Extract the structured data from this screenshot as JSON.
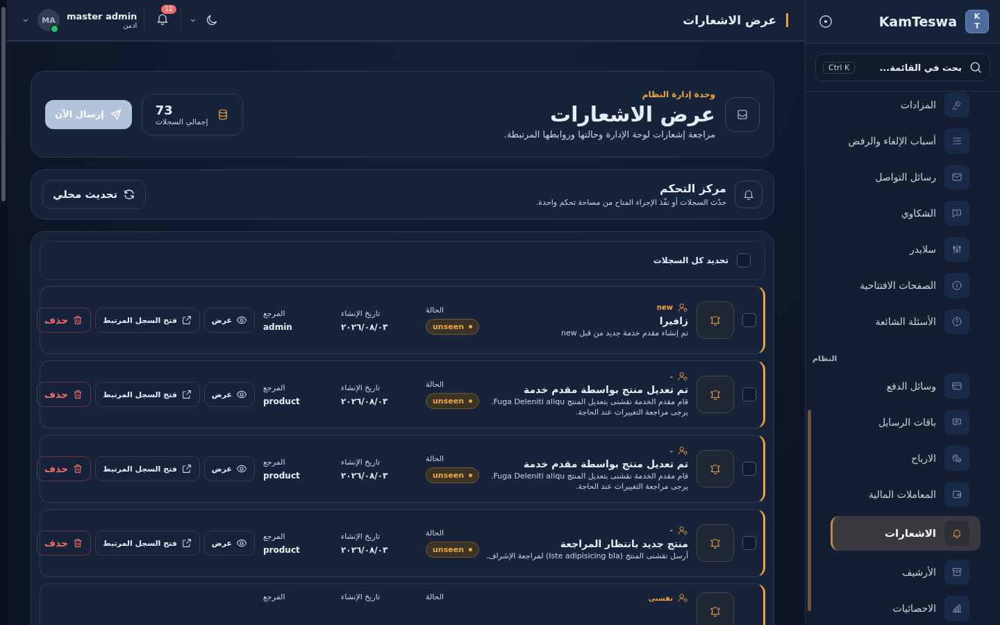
{
  "header": {
    "title": "عرض الاشعارات",
    "user": {
      "initials": "MA",
      "name": "master admin",
      "role": "ادمن",
      "online": true
    },
    "notifications_count": "12"
  },
  "sidebar": {
    "brand": {
      "logo": [
        "K",
        "T"
      ],
      "name": "KamTeswa"
    },
    "search": {
      "placeholder": "بحث في القائمة...",
      "shortcut": "Ctrl K"
    },
    "groups": [
      {
        "items": [
          {
            "label": "المزادات",
            "selected": false
          },
          {
            "label": "أسباب الإلغاء والرفض",
            "selected": false
          },
          {
            "label": "رسائل التواصل",
            "selected": false
          },
          {
            "label": "الشكاوي",
            "selected": false
          },
          {
            "label": "سلايدر",
            "selected": false
          },
          {
            "label": "الصفحات الافتتاحية",
            "selected": false
          },
          {
            "label": "الأسئلة الشائعة",
            "selected": false
          }
        ]
      },
      {
        "heading": "النظام",
        "items": [
          {
            "label": "وسائل الدفع",
            "selected": false
          },
          {
            "label": "باقات الرسايل",
            "selected": false
          },
          {
            "label": "الارباح",
            "selected": false
          },
          {
            "label": "المعاملات المالية",
            "selected": false
          },
          {
            "label": "الاشعارات",
            "selected": true
          },
          {
            "label": "الأرشيف",
            "selected": false
          },
          {
            "label": "الاحصائيات",
            "selected": false
          }
        ]
      }
    ]
  },
  "hero": {
    "eyebrow": "وحدة إدارة النظام",
    "title": "عرض الاشعارات",
    "subtitle": "مراجعة إشعارات لوحة الإدارة وحالتها وروابطها المرتبطة.",
    "stat": {
      "value": "73",
      "label": "إجمالي السجلات"
    },
    "button": "إرسال الآن"
  },
  "control": {
    "title": "مركز التحكم",
    "subtitle": "حدّث السجلات أو نفّذ الإجراء المتاح من مساحة تحكم واحدة.",
    "button": "تحديث محلي"
  },
  "list": {
    "select_all": {
      "label": "تحديد كل السجلات",
      "checked": false
    },
    "items": [
      {
        "checked": false,
        "tag": "new",
        "title": "زافيرا",
        "body": "تم إنشاء مقدم خدمة جديد من قبل new",
        "status_label": "الحالة",
        "status": "unseen",
        "date_label": "تاريخ الإنشاء",
        "date": "٢٠٢٦/٠٨/٠٣",
        "ref_label": "المرجع",
        "ref": "admin",
        "actions": [
          "عرض",
          "فتح السجل المرتبط",
          "حذف"
        ]
      },
      {
        "checked": false,
        "tag": "-",
        "title": "تم تعديل منتج بواسطة مقدم خدمة",
        "body": "قام مقدم الخدمة نقشنى بتعديل المنتج Fuga Deleniti aliqu. يرجى مراجعة التغييرات عند الحاجة.",
        "status_label": "الحالة",
        "status": "unseen",
        "date_label": "تاريخ الإنشاء",
        "date": "٢٠٢٦/٠٨/٠٣",
        "ref_label": "المرجع",
        "ref": "product",
        "actions": [
          "عرض",
          "فتح السجل المرتبط",
          "حذف"
        ]
      },
      {
        "checked": false,
        "tag": "-",
        "title": "تم تعديل منتج بواسطة مقدم خدمة",
        "body": "قام مقدم الخدمة نقشنى بتعديل المنتج Fuga Deleniti aliqu. يرجى مراجعة التغييرات عند الحاجة.",
        "status_label": "الحالة",
        "status": "unseen",
        "date_label": "تاريخ الإنشاء",
        "date": "٢٠٢٦/٠٨/٠٣",
        "ref_label": "المرجع",
        "ref": "product",
        "actions": [
          "عرض",
          "فتح السجل المرتبط",
          "حذف"
        ]
      },
      {
        "checked": false,
        "tag": "-",
        "title": "منتج جديد بانتظار المراجعة",
        "body": "أرسل نقشنى المنتج (Iste adipisicing bla) لمراجعة الإشراف.",
        "status_label": "الحالة",
        "status": "unseen",
        "date_label": "تاريخ الإنشاء",
        "date": "٢٠٢٦/٠٨/٠٣",
        "ref_label": "المرجع",
        "ref": "product",
        "actions": [
          "عرض",
          "فتح السجل المرتبط",
          "حذف"
        ]
      },
      {
        "tag": "نقشنى",
        "status_label": "الحالة",
        "date_label": "تاريخ الإنشاء",
        "ref_label": "المرجع"
      }
    ]
  }
}
